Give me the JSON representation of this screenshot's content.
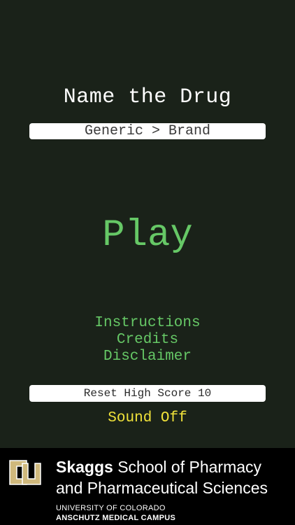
{
  "game": {
    "title": "Name the Drug",
    "mode": "Generic > Brand",
    "play_label": "Play",
    "menu": [
      {
        "label": "Instructions"
      },
      {
        "label": "Credits"
      },
      {
        "label": "Disclaimer"
      }
    ],
    "reset_label": "Reset High Score 10",
    "sound_label": "Sound Off"
  },
  "footer": {
    "school_bold": "Skaggs",
    "school_rest": " School of Pharmacy",
    "school_line2": "and Pharmaceutical Sciences",
    "university": "UNIVERSITY OF COLORADO",
    "campus": "ANSCHUTZ MEDICAL CAMPUS",
    "logo_icon": "cu-logo-icon"
  },
  "colors": {
    "background": "#1a2219",
    "accent_green": "#66c866",
    "sound_yellow": "#f0e23a",
    "logo_gold": "#cfb87c"
  }
}
